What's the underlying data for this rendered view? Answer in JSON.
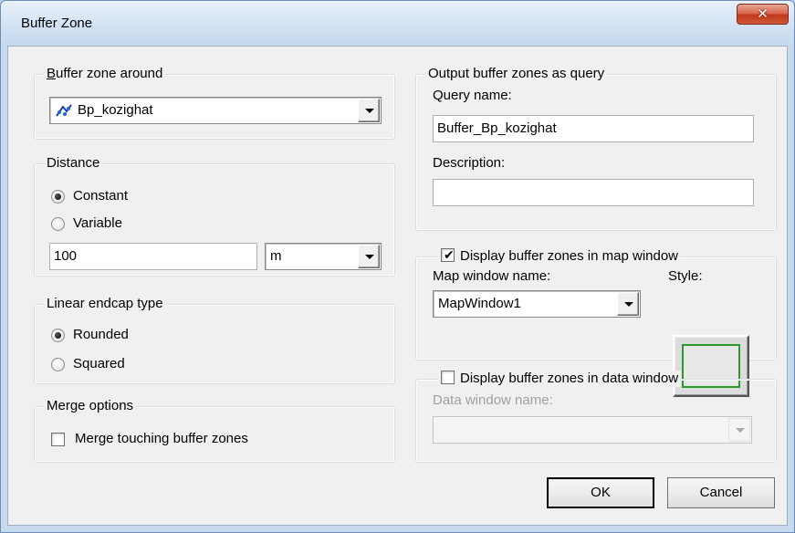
{
  "window": {
    "title": "Buffer Zone",
    "close_glyph": "✕"
  },
  "buffer_around": {
    "legend": "Buffer zone around",
    "selected": "Bp_kozighat",
    "icon": "scatter-layer-icon"
  },
  "distance": {
    "legend": "Distance",
    "constant_label": "Constant",
    "variable_label": "Variable",
    "selected": "Constant",
    "value": "100",
    "unit": "m"
  },
  "endcap": {
    "legend": "Linear endcap type",
    "rounded_label": "Rounded",
    "squared_label": "Squared",
    "selected": "Rounded"
  },
  "merge": {
    "legend": "Merge options",
    "checkbox_label": "Merge touching buffer zones",
    "checked": false
  },
  "output_query": {
    "legend": "Output buffer zones as query",
    "query_name_label": "Query name:",
    "query_name_value": "Buffer_Bp_kozighat",
    "description_label": "Description:",
    "description_value": ""
  },
  "map_window": {
    "checkbox_label": "Display buffer zones in map window",
    "checked": true,
    "name_label": "Map window name:",
    "name_value": "MapWindow1",
    "style_label": "Style:",
    "style_border_color": "#2a9a2a"
  },
  "data_window": {
    "checkbox_label": "Display buffer zones in data window",
    "checked": false,
    "name_label": "Data window name:",
    "name_value": ""
  },
  "buttons": {
    "ok": "OK",
    "cancel": "Cancel"
  }
}
